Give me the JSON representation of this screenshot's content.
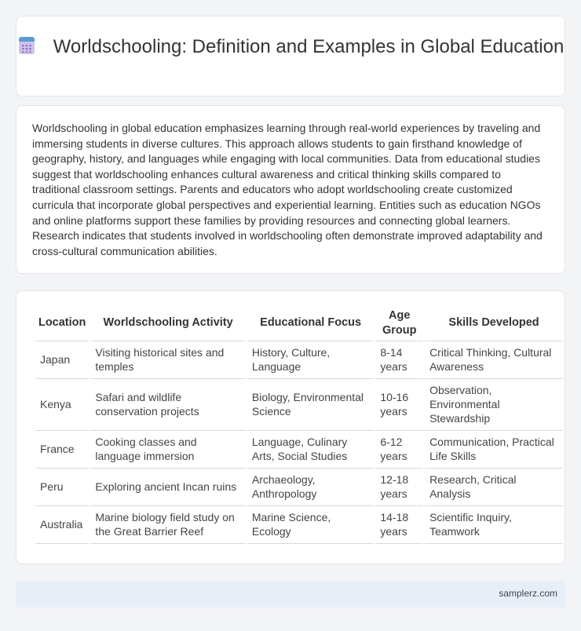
{
  "header": {
    "title": "Worldschooling: Definition and Examples in Global Education",
    "icon": "calendar-icon"
  },
  "intro": {
    "text": "Worldschooling in global education emphasizes learning through real-world experiences by traveling and immersing students in diverse cultures. This approach allows students to gain firsthand knowledge of geography, history, and languages while engaging with local communities. Data from educational studies suggest that worldschooling enhances cultural awareness and critical thinking skills compared to traditional classroom settings. Parents and educators who adopt worldschooling create customized curricula that incorporate global perspectives and experiential learning. Entities such as education NGOs and online platforms support these families by providing resources and connecting global learners. Research indicates that students involved in worldschooling often demonstrate improved adaptability and cross-cultural communication abilities."
  },
  "table": {
    "headers": [
      "Location",
      "Worldschooling Activity",
      "Educational Focus",
      "Age Group",
      "Skills Developed"
    ],
    "rows": [
      [
        "Japan",
        "Visiting historical sites and temples",
        "History, Culture, Language",
        "8-14 years",
        "Critical Thinking, Cultural Awareness"
      ],
      [
        "Kenya",
        "Safari and wildlife conservation projects",
        "Biology, Environmental Science",
        "10-16 years",
        "Observation, Environmental Stewardship"
      ],
      [
        "France",
        "Cooking classes and language immersion",
        "Language, Culinary Arts, Social Studies",
        "6-12 years",
        "Communication, Practical Life Skills"
      ],
      [
        "Peru",
        "Exploring ancient Incan ruins",
        "Archaeology, Anthropology",
        "12-18 years",
        "Research, Critical Analysis"
      ],
      [
        "Australia",
        "Marine biology field study on the Great Barrier Reef",
        "Marine Science, Ecology",
        "14-18 years",
        "Scientific Inquiry, Teamwork"
      ]
    ]
  },
  "footer": {
    "site": "samplerz.com"
  }
}
